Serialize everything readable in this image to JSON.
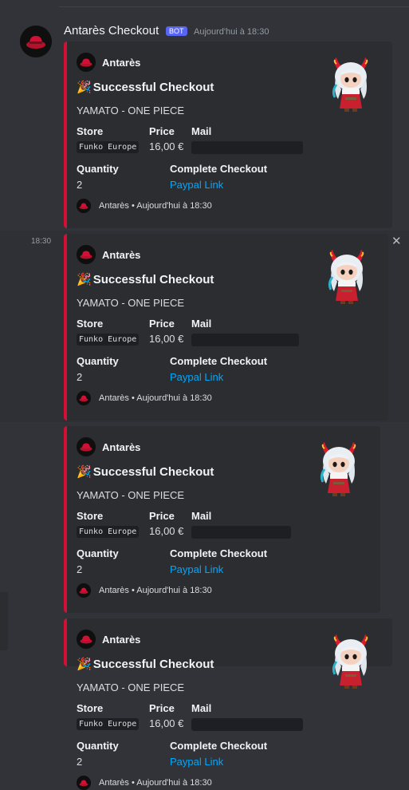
{
  "message": {
    "author": "Antarès Checkout",
    "bot_tag": "BOT",
    "timestamp": "Aujourd'hui à 18:30",
    "hover_time": "18:30",
    "close_glyph": "✕"
  },
  "embed": {
    "author": "Antarès",
    "title_icon": "🎉",
    "title": "Successful Checkout",
    "description": "YAMATO - ONE PIECE",
    "fields": {
      "store_name": "Store",
      "store_value": "Funko Europe",
      "price_name": "Price",
      "price_value": "16,00 €",
      "mail_name": "Mail",
      "quantity_name": "Quantity",
      "quantity_value": "2",
      "complete_name": "Complete Checkout",
      "complete_link": "Paypal Link"
    },
    "footer": "Antarès • Aujourd'hui à 18:30"
  },
  "colors": {
    "accent_red": "#d40f35",
    "link_blue": "#00a8fc",
    "bot_tag": "#5865f2"
  }
}
